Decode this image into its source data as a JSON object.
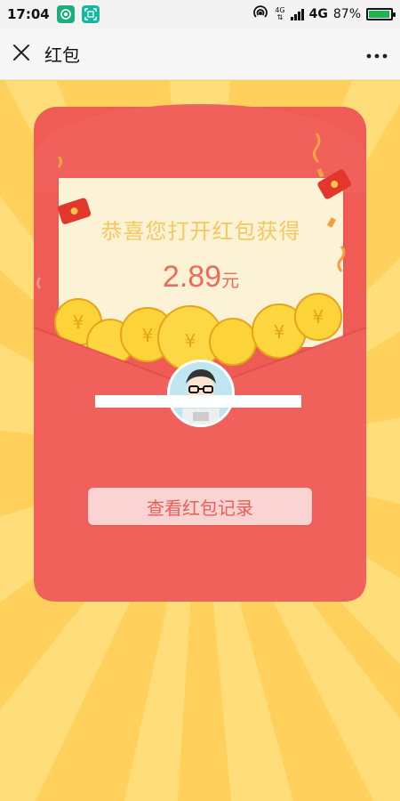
{
  "status_bar": {
    "time": "17:04",
    "network_small_top": "4G",
    "network_label": "4G",
    "battery_percent": "87%",
    "battery_level": 0.87,
    "icons": [
      "app-notification-icon",
      "screenshot-icon",
      "hotspot-icon",
      "signal-icon",
      "battery-icon"
    ]
  },
  "title_bar": {
    "title": "红包",
    "close_icon": "close-icon",
    "more_icon": "more-icon"
  },
  "red_packet": {
    "congrats_text": "恭喜您打开红包获得",
    "amount": "2.89",
    "unit": "元",
    "record_button_label": "查看红包记录"
  },
  "colors": {
    "background": "#ffd15c",
    "envelope": "#ef5b55",
    "letter": "#fcf2d6",
    "amount_text": "#ee6a5a",
    "congrats_text": "#f5c85e",
    "button_bg": "#fbd3d3"
  }
}
